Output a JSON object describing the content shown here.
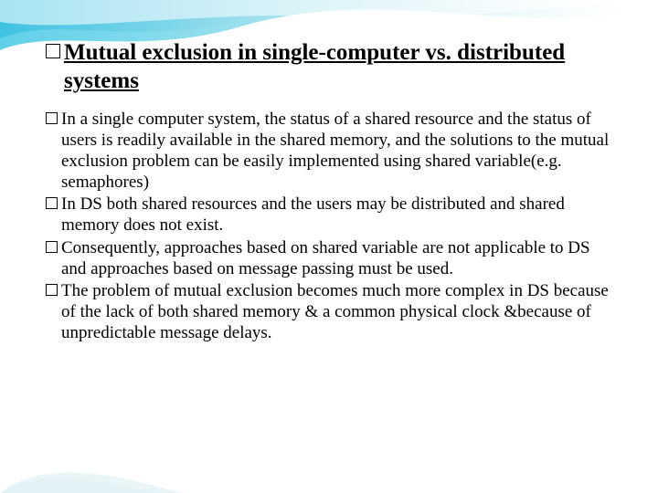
{
  "slide": {
    "title": "Mutual exclusion in single-computer vs. distributed systems",
    "bullets": [
      "In a single computer system, the status of a shared resource and the status of users is readily available in the shared memory, and the solutions to the mutual exclusion problem can be easily implemented using shared variable(e.g. semaphores)",
      "In DS both shared resources and the users may be distributed and shared memory does not exist.",
      "Consequently, approaches based on shared variable are not applicable to DS and approaches based on message passing must be used.",
      "The problem of mutual exclusion becomes much more complex in DS because of the lack of both shared memory & a common physical clock &because of unpredictable message delays."
    ]
  }
}
